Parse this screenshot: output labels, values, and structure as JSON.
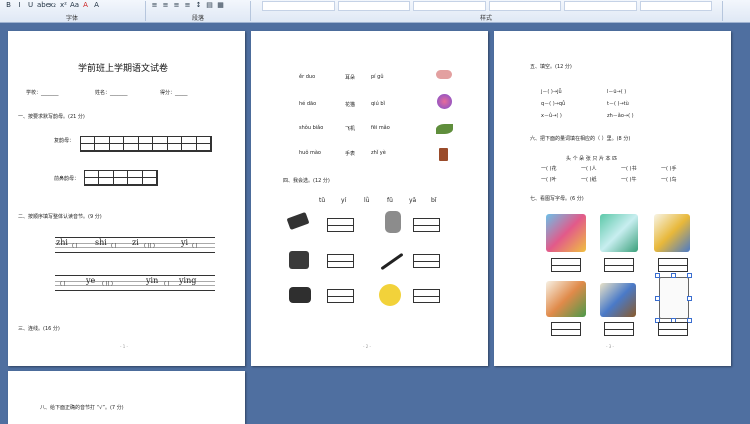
{
  "ribbon": {
    "group_font": "字体",
    "group_paragraph": "段落",
    "group_style": "样式",
    "font_buttons": [
      "B",
      "I",
      "U",
      "abe",
      "x₂",
      "x²",
      "Aa",
      "A",
      "A"
    ]
  },
  "page1": {
    "title": "学前班上学期语文试卷",
    "info_school": "学校：_______",
    "info_name": "姓名：_______",
    "info_score": "得分：_____",
    "q1": "一、按要求默写韵母。(21 分)",
    "q1_label_a": "复韵母：",
    "q1_label_b": "前鼻韵母：",
    "q2": "二、按顺序填写整体认读音节。(9 分)",
    "q2_line1": [
      "zhi",
      "shi",
      "zi",
      "yi"
    ],
    "q2_line2": [
      "ye",
      "yin",
      "ying"
    ],
    "q3": "三、连线。(16 分)",
    "page_num": "- 1 -"
  },
  "page2": {
    "pairs": [
      {
        "a": "ěr duo",
        "b": "耳朵",
        "c": "pí gǔ"
      },
      {
        "a": "hé dāo",
        "b": "花猫",
        "c": "qiú bǐ"
      },
      {
        "a": "shǒu biǎo",
        "b": "飞机",
        "c": "fēi mǎo"
      },
      {
        "a": "huǒ mào",
        "b": "手表",
        "c": "zhǐ yè"
      }
    ],
    "q4": "四、我会选。(12 分)",
    "tones": [
      "tǔ",
      "yí",
      "lǜ",
      "fǔ",
      "yā",
      "bǐ"
    ],
    "page_num": "- 2 -"
  },
  "page3": {
    "q5": "五、填空。(12 分)",
    "fill": [
      {
        "l": "j－(   )→jǖ",
        "r": "l－ü→(   )"
      },
      {
        "l": "q－(   )→qǚ",
        "r": "t－(   )→tù"
      },
      {
        "l": "x－ǜ→(   )",
        "r": "zh－ǎo→(   )"
      }
    ],
    "q6": "六、把下面的量词填在相应的（ ）里。(8 分)",
    "measure_words": "头  个  朵  张  只  片  本  匹",
    "measure_rows": [
      [
        "一(  )花",
        "一(  )人",
        "一(  )书",
        "一(  )手"
      ],
      [
        "一(  )叶",
        "一(  )纸",
        "一(  )牛",
        "一(  )鸟"
      ]
    ],
    "q7": "七、看图写字母。(6 分)",
    "page_num": "- 3 -"
  },
  "page4": {
    "q8": "八、给下面正确的音节打 “√”。(7 分)"
  }
}
